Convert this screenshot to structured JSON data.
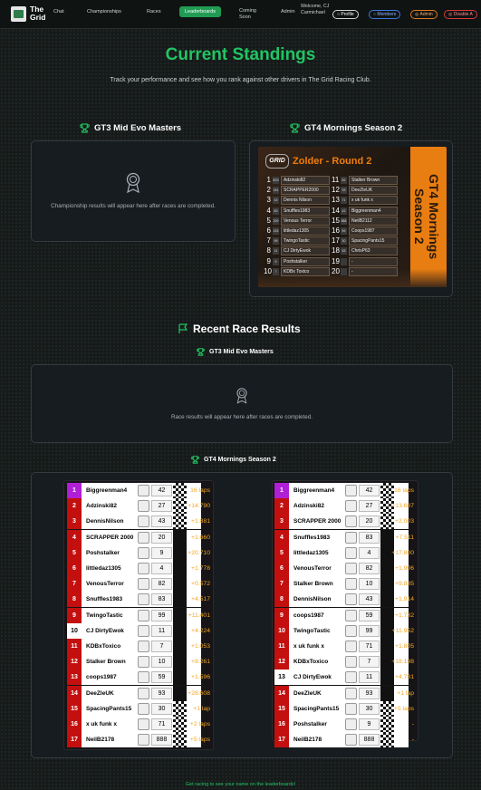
{
  "nav": {
    "brand": "The Grid",
    "items": [
      "Chat",
      "Championships",
      "Races",
      "Leaderboards",
      "Coming Soon",
      "Admin"
    ],
    "active": "Leaderboards",
    "welcome": "Welcome, CJ Carmichael",
    "buttons": {
      "profile": "Profile",
      "members": "Members",
      "admin": "Admin",
      "disable": "Disable A"
    }
  },
  "page": {
    "title": "Current Standings",
    "subtitle": "Track your performance and see how you rank against other drivers in The Grid Racing Club."
  },
  "standings": {
    "gt3": {
      "title": "GT3 Mid Evo Masters",
      "empty": "Championship results will appear here after races are completed."
    },
    "gt4": {
      "title": "GT4 Mornings Season 2",
      "poster_heading": "Zolder - Round 2",
      "poster_series": "GT4 Mornings Season 2",
      "left": [
        {
          "p": "1",
          "c": "5SS",
          "d": "Adzinski82"
        },
        {
          "p": "2",
          "c": "181",
          "d": "SCRAPPER2000"
        },
        {
          "p": "3",
          "c": "43",
          "d": "Dennis Nilson"
        },
        {
          "p": "4",
          "c": "83",
          "d": "Snuffles1983"
        },
        {
          "p": "5",
          "c": "229",
          "d": "Venous Terror"
        },
        {
          "p": "6",
          "c": "215",
          "d": "littledaz1305"
        },
        {
          "p": "7",
          "c": "99",
          "d": "TwingoTastic"
        },
        {
          "p": "8",
          "c": "11",
          "d": "CJ DirtyEwok"
        },
        {
          "p": "9",
          "c": "9",
          "d": "Poshstalker"
        },
        {
          "p": "10",
          "c": "7",
          "d": "KDBx Toxico"
        }
      ],
      "right": [
        {
          "p": "11",
          "c": "82",
          "d": "Stalker Brown"
        },
        {
          "p": "12",
          "c": "93",
          "d": "DeeZleUK"
        },
        {
          "p": "13",
          "c": "71",
          "d": "x uk funk x"
        },
        {
          "p": "14",
          "c": "42",
          "d": "Biggreenman4"
        },
        {
          "p": "15",
          "c": "888",
          "d": "NeilB2112"
        },
        {
          "p": "16",
          "c": "59",
          "d": "Coops1987"
        },
        {
          "p": "17",
          "c": "30",
          "d": "SpacingPants15"
        },
        {
          "p": "18",
          "c": "53",
          "d": "ChrisP63"
        },
        {
          "p": "19",
          "c": "",
          "d": "-"
        },
        {
          "p": "20",
          "c": "",
          "d": "-"
        }
      ]
    }
  },
  "recent": {
    "heading": "Recent Race Results",
    "gt3": {
      "title": "GT3 Mid Evo Masters",
      "empty": "Race results will appear here after races are completed."
    },
    "gt4": {
      "title": "GT4 Mornings Season 2",
      "race1": [
        {
          "pos": "1",
          "name": "Biggreenman4",
          "num": "42",
          "gap": "16 laps"
        },
        {
          "pos": "2",
          "name": "Adzinski82",
          "num": "27",
          "gap": "+14.790"
        },
        {
          "pos": "3",
          "name": "DennisNilson",
          "num": "43",
          "gap": "+1.881"
        },
        {
          "pos": "4",
          "name": "SCRAPPER 2000",
          "num": "20",
          "gap": "+1.660"
        },
        {
          "pos": "5",
          "name": "Poshstalker",
          "num": "9",
          "gap": "+20.710"
        },
        {
          "pos": "6",
          "name": "littledaz1305",
          "num": "4",
          "gap": "+1.778"
        },
        {
          "pos": "7",
          "name": "VenousTerror",
          "num": "82",
          "gap": "+0.572"
        },
        {
          "pos": "8",
          "name": "Snuffles1983",
          "num": "83",
          "gap": "+4.517"
        },
        {
          "pos": "9",
          "name": "TwingoTastic",
          "num": "99",
          "gap": "+11.401"
        },
        {
          "pos": "10",
          "name": "CJ DirtyEwok",
          "num": "11",
          "gap": "+4.224"
        },
        {
          "pos": "11",
          "name": "KDBxToxico",
          "num": "7",
          "gap": "+1.053"
        },
        {
          "pos": "12",
          "name": "Stalker Brown",
          "num": "10",
          "gap": "+8.261"
        },
        {
          "pos": "13",
          "name": "coops1987",
          "num": "59",
          "gap": "+1.596"
        },
        {
          "pos": "14",
          "name": "DeeZleUK",
          "num": "93",
          "gap": "+28.608"
        },
        {
          "pos": "15",
          "name": "SpacingPants15",
          "num": "30",
          "gap": "+1 lap"
        },
        {
          "pos": "16",
          "name": "x uk funk x",
          "num": "71",
          "gap": "+2 laps"
        },
        {
          "pos": "17",
          "name": "NeilB2178",
          "num": "888",
          "gap": "+5 laps"
        }
      ],
      "race2": [
        {
          "pos": "1",
          "name": "Biggreenman4",
          "num": "42",
          "gap": "16 laps"
        },
        {
          "pos": "2",
          "name": "Adzinski82",
          "num": "27",
          "gap": "+13.687"
        },
        {
          "pos": "3",
          "name": "SCRAPPER 2000",
          "num": "20",
          "gap": "+2.003"
        },
        {
          "pos": "4",
          "name": "Snuffles1983",
          "num": "83",
          "gap": "+7.511"
        },
        {
          "pos": "5",
          "name": "littledaz1305",
          "num": "4",
          "gap": "+17.800"
        },
        {
          "pos": "6",
          "name": "VenousTerror",
          "num": "82",
          "gap": "+1.906"
        },
        {
          "pos": "7",
          "name": "Stalker Brown",
          "num": "10",
          "gap": "+9.835"
        },
        {
          "pos": "8",
          "name": "DennisNilson",
          "num": "43",
          "gap": "+1.914"
        },
        {
          "pos": "9",
          "name": "coops1987",
          "num": "59",
          "gap": "+1.732"
        },
        {
          "pos": "10",
          "name": "TwingoTastic",
          "num": "99",
          "gap": "+11.952"
        },
        {
          "pos": "11",
          "name": "x uk funk x",
          "num": "71",
          "gap": "+1.805"
        },
        {
          "pos": "12",
          "name": "KDBxToxico",
          "num": "7",
          "gap": "+18.198"
        },
        {
          "pos": "13",
          "name": "CJ DirtyEwok",
          "num": "11",
          "gap": "+4.781"
        },
        {
          "pos": "14",
          "name": "DeeZleUK",
          "num": "93",
          "gap": "+1 lap"
        },
        {
          "pos": "15",
          "name": "SpacingPants15",
          "num": "30",
          "gap": "+5 laps"
        },
        {
          "pos": "16",
          "name": "Poshstalker",
          "num": "9",
          "gap": "-"
        },
        {
          "pos": "17",
          "name": "NeilB2178",
          "num": "888",
          "gap": "-"
        }
      ]
    }
  },
  "footer": "Get racing to see your name on the leaderboards!",
  "colors": {
    "accent": "#22c463",
    "active_nav": "#219c54",
    "pos_red": "#c40f0f",
    "pos_purple": "#b01fd6",
    "gap_orange": "#f5a623",
    "poster_orange": "#e87d12"
  }
}
